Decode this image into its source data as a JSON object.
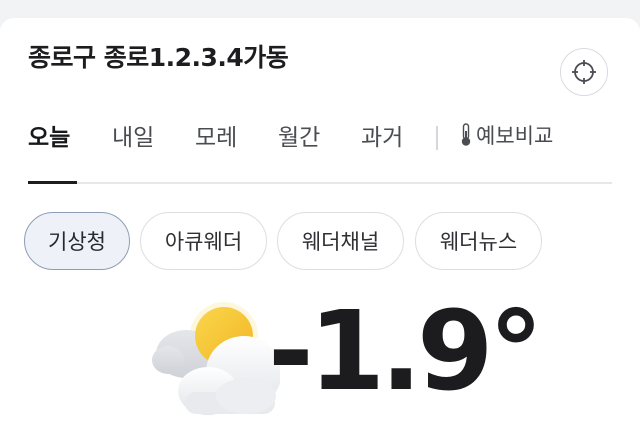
{
  "header": {
    "location": "종로구 종로1.2.3.4가동",
    "locate_icon": "crosshair-icon"
  },
  "tabs": [
    {
      "label": "오늘",
      "active": true
    },
    {
      "label": "내일",
      "active": false
    },
    {
      "label": "모레",
      "active": false
    },
    {
      "label": "월간",
      "active": false
    },
    {
      "label": "과거",
      "active": false
    }
  ],
  "compare": {
    "label": "예보비교",
    "icon": "thermometer-icon"
  },
  "sources": [
    {
      "label": "기상청",
      "selected": true
    },
    {
      "label": "아큐웨더",
      "selected": false
    },
    {
      "label": "웨더채널",
      "selected": false
    },
    {
      "label": "웨더뉴스",
      "selected": false
    }
  ],
  "current": {
    "temperature": "-1.9°",
    "condition_icon": "partly-cloudy-icon"
  },
  "colors": {
    "accent_dark": "#1d1d1f",
    "chip_selected_bg": "#eef2f8",
    "chip_selected_border": "#8e9db6",
    "sun": "#f5c431"
  }
}
